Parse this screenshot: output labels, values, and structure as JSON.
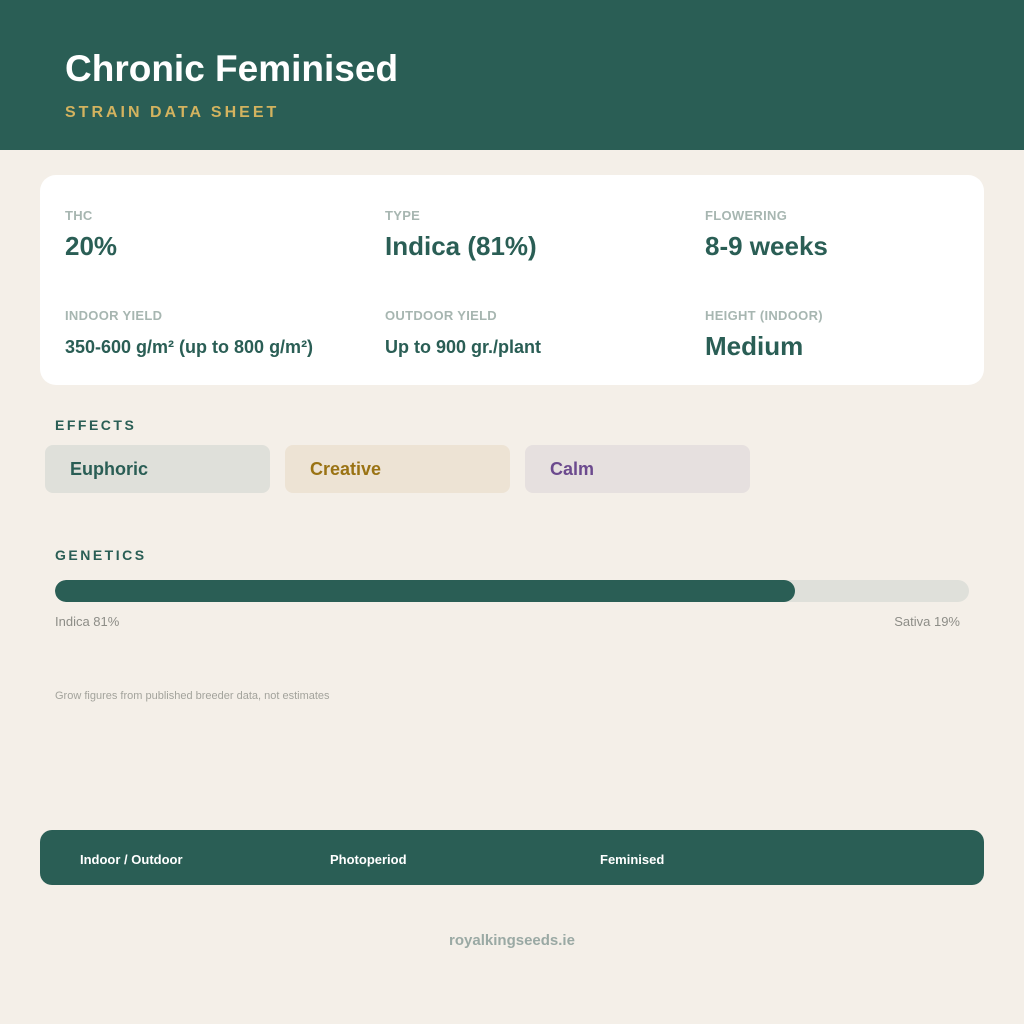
{
  "header": {
    "title": "Chronic Feminised",
    "subtitle": "STRAIN DATA SHEET"
  },
  "stats": {
    "thc": {
      "label": "THC",
      "value": "20%"
    },
    "type": {
      "label": "TYPE",
      "value": "Indica (81%)"
    },
    "flowering": {
      "label": "FLOWERING",
      "value": "8-9 weeks"
    },
    "indoor_yield": {
      "label": "INDOOR YIELD",
      "value": "350-600 g/m² (up to 800 g/m²)"
    },
    "outdoor_yield": {
      "label": "OUTDOOR YIELD",
      "value": "Up to 900 gr./plant"
    },
    "height": {
      "label": "HEIGHT (INDOOR)",
      "value": "Medium"
    }
  },
  "effects": {
    "title": "EFFECTS",
    "items": [
      "Euphoric",
      "Creative",
      "Calm"
    ]
  },
  "genetics": {
    "title": "GENETICS",
    "indica_percent": 81,
    "sativa_percent": 19,
    "indica_label": "Indica 81%",
    "sativa_label": "Sativa 19%"
  },
  "footnote": "Grow figures from published breeder data, not estimates",
  "footer_tags": [
    "Indoor / Outdoor",
    "Photoperiod",
    "Feminised"
  ],
  "website": "royalkingseeds.ie",
  "colors": {
    "primary": "#2a5e55",
    "accent": "#d3b35f",
    "background": "#f4efe8",
    "creative": "#9a7314",
    "calm": "#6c4a8e"
  }
}
